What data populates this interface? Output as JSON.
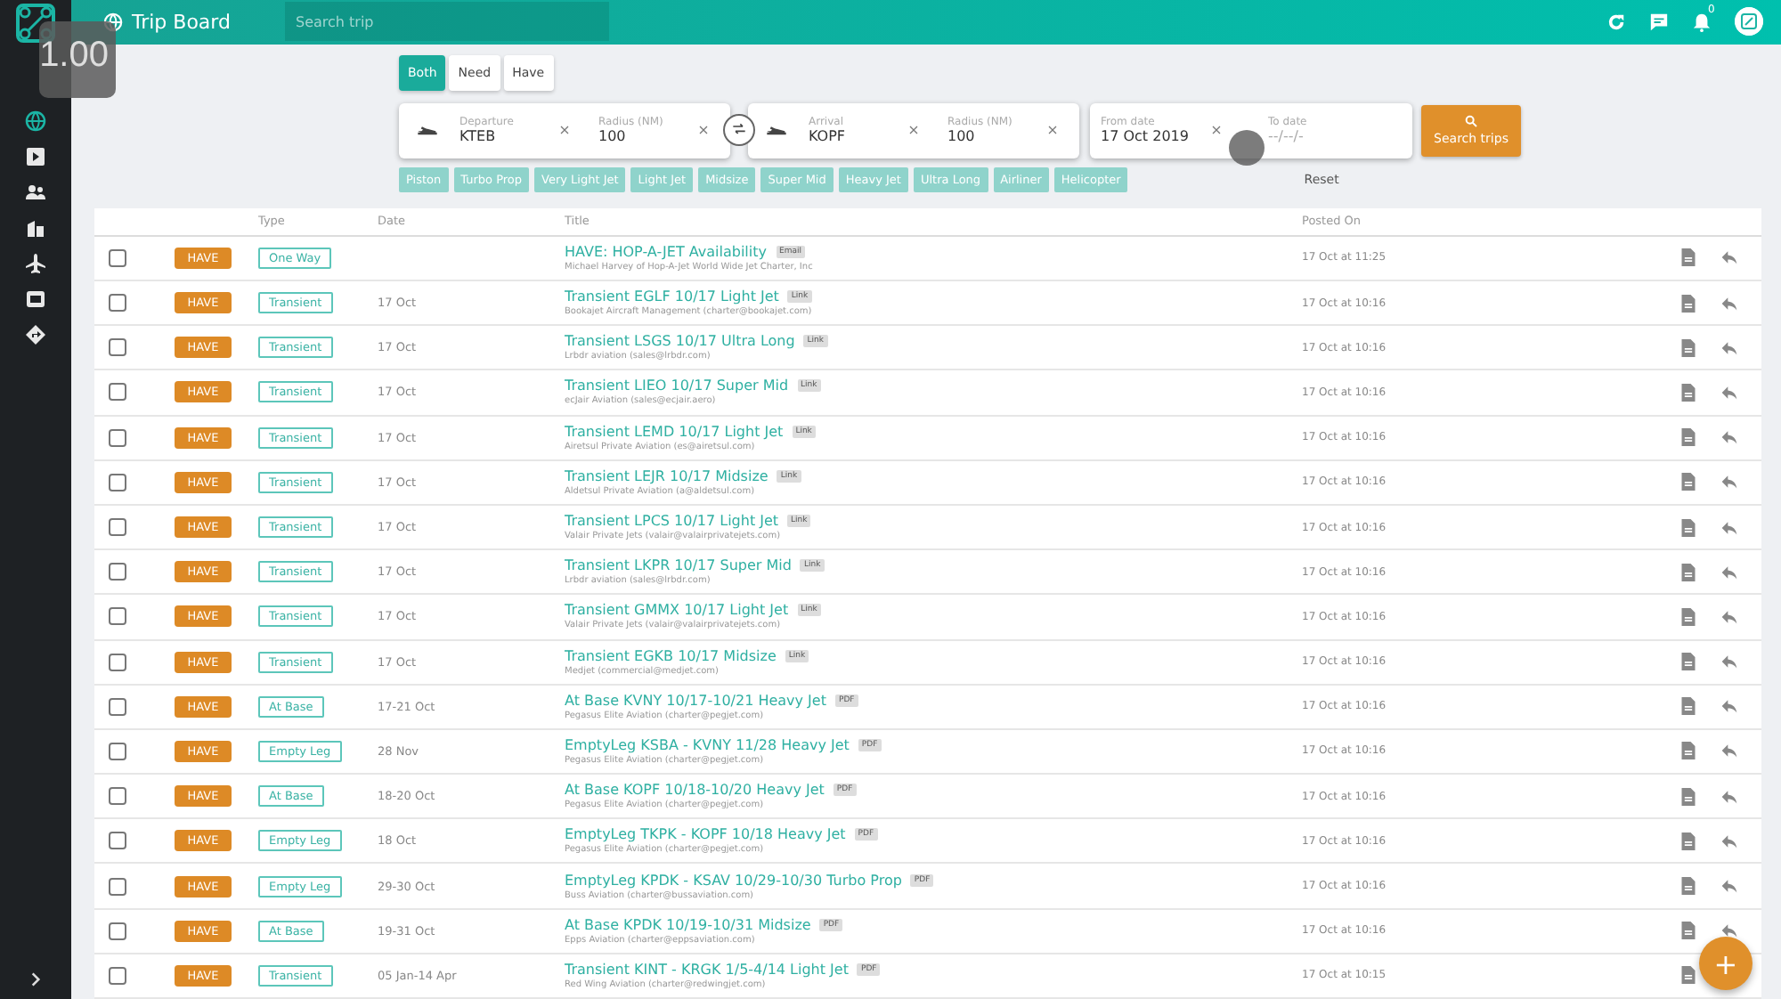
{
  "app_header": {
    "title": "Trip Board",
    "search_placeholder": "Search trip",
    "notification_count": "0"
  },
  "zoom_overlay": "1.00",
  "sidebar": {
    "items": [
      {
        "kind": "globe",
        "selected": true
      },
      {
        "kind": "play",
        "selected": false
      },
      {
        "kind": "users",
        "selected": false
      },
      {
        "kind": "building",
        "selected": false
      },
      {
        "kind": "plane",
        "selected": false
      },
      {
        "kind": "card",
        "selected": false
      },
      {
        "kind": "route",
        "selected": false
      }
    ]
  },
  "filters": {
    "trade_toggle": [
      {
        "label": "Both",
        "selected": true
      },
      {
        "label": "Need",
        "selected": false
      },
      {
        "label": "Have",
        "selected": false
      }
    ],
    "departure": {
      "label": "Departure",
      "value": "KTEB"
    },
    "departure_radius": {
      "label": "Radius (NM)",
      "value": "100"
    },
    "arrival": {
      "label": "Arrival",
      "value": "KOPF"
    },
    "arrival_radius": {
      "label": "Radius (NM)",
      "value": "100"
    },
    "from_date": {
      "label": "From date",
      "value": "17 Oct 2019"
    },
    "to_date": {
      "label": "To date",
      "placeholder": "--/--/-"
    },
    "search_button": "Search trips",
    "categories": [
      {
        "label": "Piston"
      },
      {
        "label": "Turbo Prop"
      },
      {
        "label": "Very Light Jet"
      },
      {
        "label": "Light Jet"
      },
      {
        "label": "Midsize"
      },
      {
        "label": "Super Mid"
      },
      {
        "label": "Heavy Jet"
      },
      {
        "label": "Ultra Long"
      },
      {
        "label": "Airliner"
      },
      {
        "label": "Helicopter"
      }
    ],
    "reset": "Reset"
  },
  "table": {
    "columns": [
      "Type",
      "Date",
      "Title",
      "Posted On"
    ],
    "rows": [
      {
        "checked": false,
        "side": "HAVE",
        "type": "One Way",
        "date": "",
        "title": "HAVE: HOP-A-JET Availability",
        "tag": "Email",
        "subtitle": "Michael Harvey of Hop-A-Jet World Wide Jet Charter, Inc",
        "posted": "17 Oct at 11:25",
        "reply_visible": true
      },
      {
        "checked": false,
        "side": "HAVE",
        "type": "Transient",
        "date": "17 Oct",
        "title": "Transient EGLF 10/17 Light Jet",
        "tag": "Link",
        "subtitle": "Bookajet Aircraft Management (charter@bookajet.com)",
        "posted": "17 Oct at 10:16",
        "reply_visible": true
      },
      {
        "checked": false,
        "side": "HAVE",
        "type": "Transient",
        "date": "17 Oct",
        "title": "Transient LSGS 10/17 Ultra Long",
        "tag": "Link",
        "subtitle": "Lrbdr aviation (sales@lrbdr.com)",
        "posted": "17 Oct at 10:16",
        "reply_visible": true
      },
      {
        "checked": false,
        "side": "HAVE",
        "type": "Transient",
        "date": "17 Oct",
        "title": "Transient LIEO 10/17 Super Mid",
        "tag": "Link",
        "subtitle": "ecJair Aviation (sales@ecjair.aero)",
        "posted": "17 Oct at 10:16",
        "reply_visible": true
      },
      {
        "checked": false,
        "side": "HAVE",
        "type": "Transient",
        "date": "17 Oct",
        "title": "Transient LEMD 10/17 Light Jet",
        "tag": "Link",
        "subtitle": "Airetsul Private Aviation (es@airetsul.com)",
        "posted": "17 Oct at 10:16",
        "reply_visible": true
      },
      {
        "checked": false,
        "side": "HAVE",
        "type": "Transient",
        "date": "17 Oct",
        "title": "Transient LEJR 10/17 Midsize",
        "tag": "Link",
        "subtitle": "Aldetsul Private Aviation (a@aldetsul.com)",
        "posted": "17 Oct at 10:16",
        "reply_visible": true
      },
      {
        "checked": false,
        "side": "HAVE",
        "type": "Transient",
        "date": "17 Oct",
        "title": "Transient LPCS 10/17 Light Jet",
        "tag": "Link",
        "subtitle": "Valair Private Jets (valair@valairprivatejets.com)",
        "posted": "17 Oct at 10:16",
        "reply_visible": true
      },
      {
        "checked": false,
        "side": "HAVE",
        "type": "Transient",
        "date": "17 Oct",
        "title": "Transient LKPR 10/17 Super Mid",
        "tag": "Link",
        "subtitle": "Lrbdr aviation (sales@lrbdr.com)",
        "posted": "17 Oct at 10:16",
        "reply_visible": true
      },
      {
        "checked": false,
        "side": "HAVE",
        "type": "Transient",
        "date": "17 Oct",
        "title": "Transient GMMX 10/17 Light Jet",
        "tag": "Link",
        "subtitle": "Valair Private Jets (valair@valairprivatejets.com)",
        "posted": "17 Oct at 10:16",
        "reply_visible": true
      },
      {
        "checked": false,
        "side": "HAVE",
        "type": "Transient",
        "date": "17 Oct",
        "title": "Transient EGKB 10/17 Midsize",
        "tag": "Link",
        "subtitle": "Medjet (commercial@medjet.com)",
        "posted": "17 Oct at 10:16",
        "reply_visible": true
      },
      {
        "checked": false,
        "side": "HAVE",
        "type": "At Base",
        "date": "17-21 Oct",
        "title": "At Base KVNY 10/17-10/21 Heavy Jet",
        "tag": "PDF",
        "subtitle": "Pegasus Elite Aviation (charter@pegjet.com)",
        "posted": "17 Oct at 10:16",
        "reply_visible": true
      },
      {
        "checked": false,
        "side": "HAVE",
        "type": "Empty Leg",
        "date": "28 Nov",
        "title": "EmptyLeg KSBA - KVNY 11/28 Heavy Jet",
        "tag": "PDF",
        "subtitle": "Pegasus Elite Aviation (charter@pegjet.com)",
        "posted": "17 Oct at 10:16",
        "reply_visible": true
      },
      {
        "checked": false,
        "side": "HAVE",
        "type": "At Base",
        "date": "18-20 Oct",
        "title": "At Base KOPF 10/18-10/20 Heavy Jet",
        "tag": "PDF",
        "subtitle": "Pegasus Elite Aviation (charter@pegjet.com)",
        "posted": "17 Oct at 10:16",
        "reply_visible": true
      },
      {
        "checked": false,
        "side": "HAVE",
        "type": "Empty Leg",
        "date": "18 Oct",
        "title": "EmptyLeg TKPK - KOPF 10/18 Heavy Jet",
        "tag": "PDF",
        "subtitle": "Pegasus Elite Aviation (charter@pegjet.com)",
        "posted": "17 Oct at 10:16",
        "reply_visible": true
      },
      {
        "checked": false,
        "side": "HAVE",
        "type": "Empty Leg",
        "date": "29-30 Oct",
        "title": "EmptyLeg KPDK - KSAV 10/29-10/30 Turbo Prop",
        "tag": "PDF",
        "subtitle": "Buss Aviation (charter@bussaviation.com)",
        "posted": "17 Oct at 10:16",
        "reply_visible": true
      },
      {
        "checked": false,
        "side": "HAVE",
        "type": "At Base",
        "date": "19-31 Oct",
        "title": "At Base KPDK 10/19-10/31 Midsize",
        "tag": "PDF",
        "subtitle": "Epps Aviation (charter@eppsaviation.com)",
        "posted": "17 Oct at 10:16",
        "reply_visible": true
      },
      {
        "checked": false,
        "side": "HAVE",
        "type": "Transient",
        "date": "05 Jan-14 Apr",
        "title": "Transient KINT - KRGK 1/5-4/14 Light Jet",
        "tag": "PDF",
        "subtitle": "Red Wing Aviation (charter@redwingjet.com)",
        "posted": "17 Oct at 10:15",
        "reply_visible": false
      }
    ]
  },
  "fab": "+"
}
